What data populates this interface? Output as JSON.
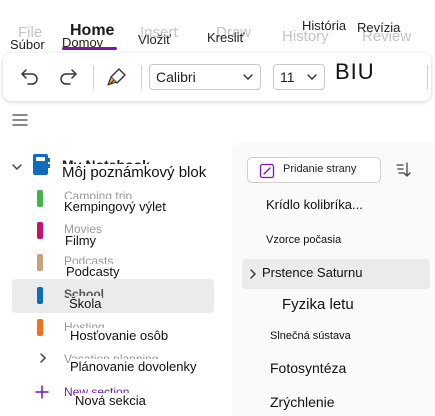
{
  "tabs": {
    "file_ghost": "File",
    "home_ghost": "Home",
    "insert_ghost": "Insert",
    "draw_ghost": "Draw",
    "history_ghost": "History",
    "review_ghost": "Review",
    "file": "Súbor",
    "home": "Domov",
    "insert": "Vložiť",
    "draw": "Kresliť",
    "history": "História",
    "review": "Revízia"
  },
  "ribbon": {
    "font_name": "Calibri",
    "font_size": "11",
    "format_label": "BIU"
  },
  "notebook": {
    "ghost_title": "My Notebook",
    "title": "Môj poznámkový blok"
  },
  "sections": [
    {
      "ghost": "Camping trip",
      "label": "Kempingový výlet",
      "color": "#3fb44a"
    },
    {
      "ghost": "Movies",
      "label": "Filmy",
      "color": "#c4126d"
    },
    {
      "ghost": "Podcasts",
      "label": "Podcasty",
      "color": "#c8a27a"
    },
    {
      "ghost": "School",
      "label": "Škola",
      "color": "#0f6cbd"
    },
    {
      "ghost": "Hosting",
      "label": "Hosťovanie osôb",
      "color": "#f0701e"
    }
  ],
  "group": {
    "ghost": "Vacation planning",
    "label": "Plánovanie dovolenky"
  },
  "new_section": {
    "ghost": "New section",
    "label": "Nová sekcia",
    "color": "#7719aa"
  },
  "page_list": {
    "add_page": "Pridanie strany",
    "pages": [
      {
        "label": "Krídlo kolibríka..."
      },
      {
        "label": "Vzorce počasia"
      },
      {
        "label": "Prstence Saturnu"
      },
      {
        "label": "Fyzika letu"
      },
      {
        "label": "Slnečná sústava"
      },
      {
        "label": "Fotosyntéza"
      },
      {
        "label": "Zrýchlenie"
      }
    ]
  }
}
